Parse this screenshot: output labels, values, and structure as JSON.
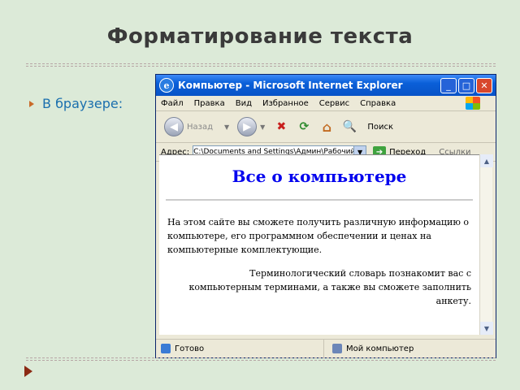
{
  "slide": {
    "title": "Форматирование текста",
    "bullet": "В браузере:"
  },
  "window": {
    "title": "Компьютер - Microsoft Internet Explorer",
    "controls": {
      "minimize": "_",
      "maximize": "□",
      "close": "✕"
    },
    "menu": [
      "Файл",
      "Правка",
      "Вид",
      "Избранное",
      "Сервис",
      "Справка"
    ],
    "toolbar": {
      "back": "Назад",
      "search": "Поиск"
    },
    "address": {
      "label": "Адрес:",
      "value": "C:\\Documents and Settings\\Админ\\Рабочий стол\\Компьютер.htm",
      "go": "Переход",
      "links": "Ссылки"
    },
    "page": {
      "heading": "Все о компьютере",
      "paragraph1": "На этом сайте вы сможете получить различную информацию о компьютере, его программном обеспечении и ценах на компьютерные комплектующие.",
      "paragraph2": "Терминологический словарь познакомит вас с компьютерным терминами, а также вы сможете заполнить анкету."
    },
    "status": {
      "left": "Готово",
      "right": "Мой компьютер"
    }
  }
}
